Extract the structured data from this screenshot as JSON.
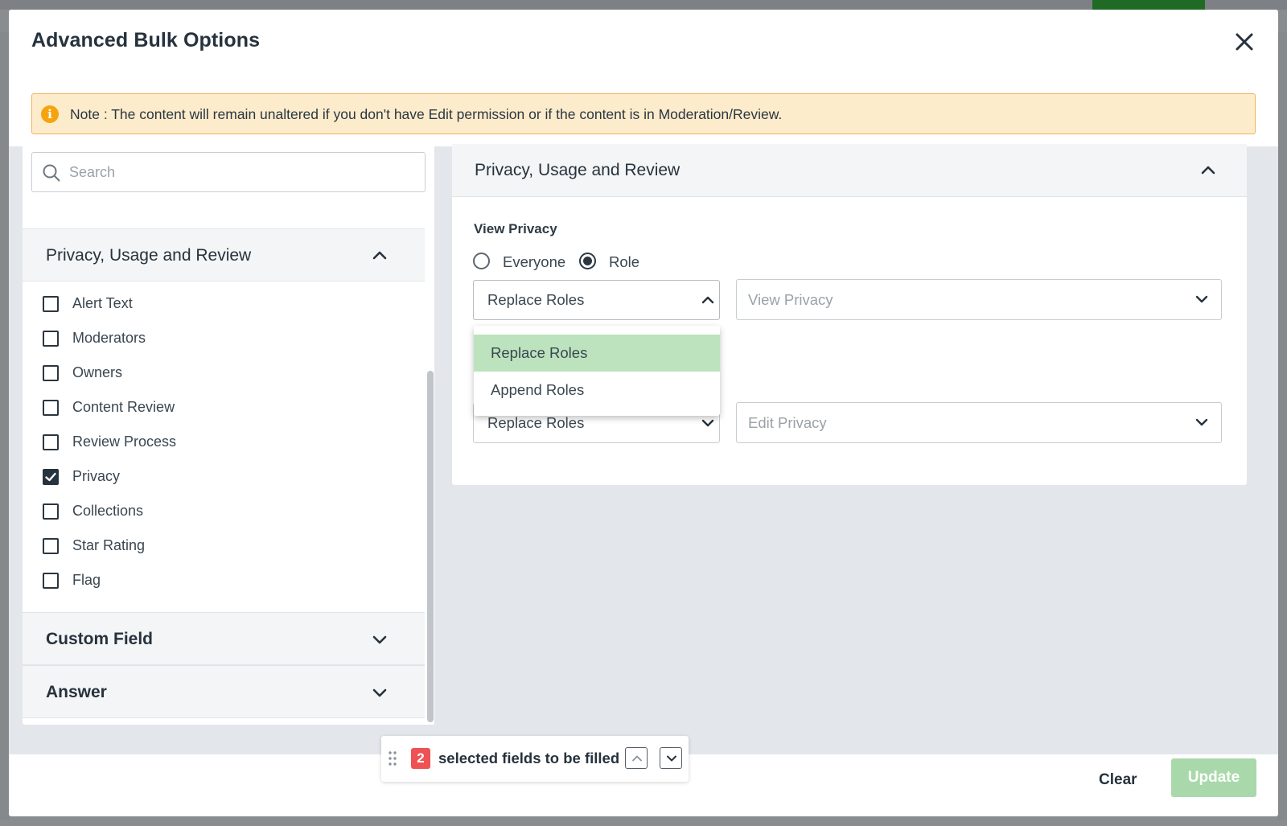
{
  "modal": {
    "title": "Advanced Bulk Options",
    "note": "Note : The content will remain unaltered if you don't have Edit permission or if the content is in Moderation/Review."
  },
  "left_panel": {
    "search_placeholder": "Search",
    "section_privacy": {
      "label": "Privacy, Usage and Review",
      "expanded": true,
      "items": [
        {
          "label": "Alert Text",
          "checked": false
        },
        {
          "label": "Moderators",
          "checked": false
        },
        {
          "label": "Owners",
          "checked": false
        },
        {
          "label": "Content Review",
          "checked": false
        },
        {
          "label": "Review Process",
          "checked": false
        },
        {
          "label": "Privacy",
          "checked": true
        },
        {
          "label": "Collections",
          "checked": false
        },
        {
          "label": "Star Rating",
          "checked": false
        },
        {
          "label": "Flag",
          "checked": false
        }
      ]
    },
    "section_custom_field": {
      "label": "Custom Field",
      "expanded": false
    },
    "section_answer": {
      "label": "Answer",
      "expanded": false
    }
  },
  "right_panel": {
    "title": "Privacy, Usage and Review",
    "view_privacy": {
      "label": "View Privacy",
      "radio_options": [
        {
          "label": "Everyone",
          "selected": false
        },
        {
          "label": "Role",
          "selected": true
        }
      ],
      "mode_select_value": "Replace Roles",
      "role_select_placeholder": "View Privacy"
    },
    "dropdown_options": [
      {
        "label": "Replace Roles",
        "active": true
      },
      {
        "label": "Append Roles",
        "active": false
      }
    ],
    "edit_privacy": {
      "mode_select_value": "Replace Roles",
      "role_select_placeholder": "Edit Privacy"
    }
  },
  "footer": {
    "selected_count": "2",
    "selected_text": "selected fields to be filled",
    "clear_label": "Clear",
    "update_label": "Update"
  },
  "colors": {
    "note_bg": "#fdeccc",
    "note_border": "#f3b35a",
    "note_icon": "#f5a40f",
    "dropdown_active": "#bce3bd",
    "update_button": "#a9d9aa",
    "badge": "#ee5254"
  },
  "icons": {
    "close": "close-icon",
    "info": "info-icon",
    "search": "search-icon",
    "chevron_up": "chevron-up-icon",
    "chevron_down": "chevron-down-icon",
    "drag": "drag-handle-icon",
    "check": "check-icon"
  }
}
